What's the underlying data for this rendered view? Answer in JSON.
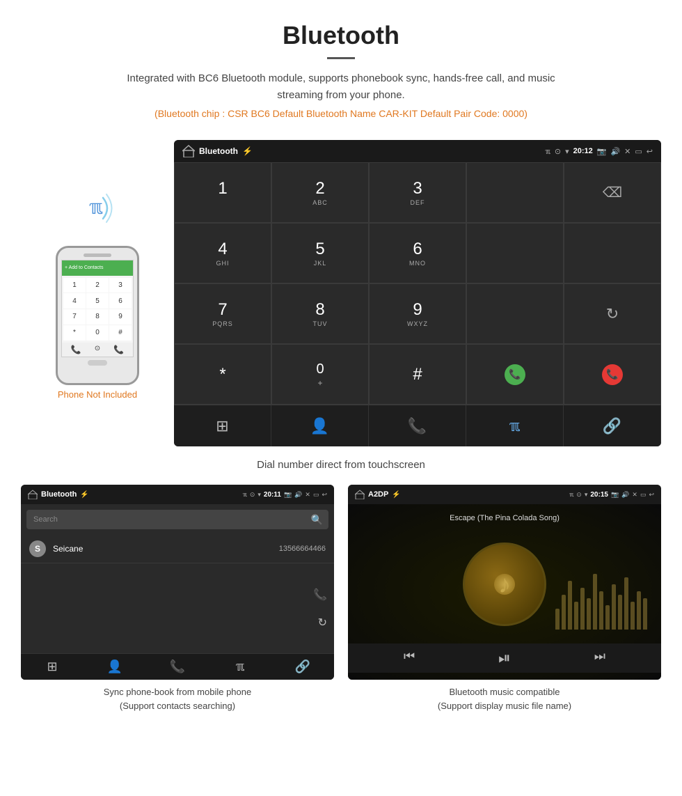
{
  "page": {
    "title": "Bluetooth",
    "description": "Integrated with BC6 Bluetooth module, supports phonebook sync, hands-free call, and music streaming from your phone.",
    "specs": "(Bluetooth chip : CSR BC6    Default Bluetooth Name CAR-KIT    Default Pair Code: 0000)",
    "dial_caption": "Dial number direct from touchscreen",
    "bottom_left_caption": "Sync phone-book from mobile phone\n(Support contacts searching)",
    "bottom_right_caption": "Bluetooth music compatible\n(Support display music file name)"
  },
  "status_bar": {
    "app_name": "Bluetooth",
    "time": "20:12",
    "app_name_left": "Bluetooth",
    "time_left": "20:11",
    "app_name_right": "A2DP",
    "time_right": "20:15"
  },
  "phone_not_included": "Phone Not Included",
  "keypad": {
    "keys": [
      {
        "num": "1",
        "sub": ""
      },
      {
        "num": "2",
        "sub": "ABC"
      },
      {
        "num": "3",
        "sub": "DEF"
      },
      {
        "num": "4",
        "sub": "GHI"
      },
      {
        "num": "5",
        "sub": "JKL"
      },
      {
        "num": "6",
        "sub": "MNO"
      },
      {
        "num": "7",
        "sub": "PQRS"
      },
      {
        "num": "8",
        "sub": "TUV"
      },
      {
        "num": "9",
        "sub": "WXYZ"
      },
      {
        "num": "*",
        "sub": ""
      },
      {
        "num": "0",
        "sub": "+"
      },
      {
        "num": "#",
        "sub": ""
      }
    ]
  },
  "phonebook": {
    "search_placeholder": "Search",
    "contact_initial": "S",
    "contact_name": "Seicane",
    "contact_number": "13566664466"
  },
  "music": {
    "song_title": "Escape (The Pina Colada Song)"
  },
  "eq_bars": [
    30,
    50,
    70,
    40,
    60,
    45,
    80,
    55,
    35,
    65,
    50,
    75,
    40,
    55,
    45
  ]
}
